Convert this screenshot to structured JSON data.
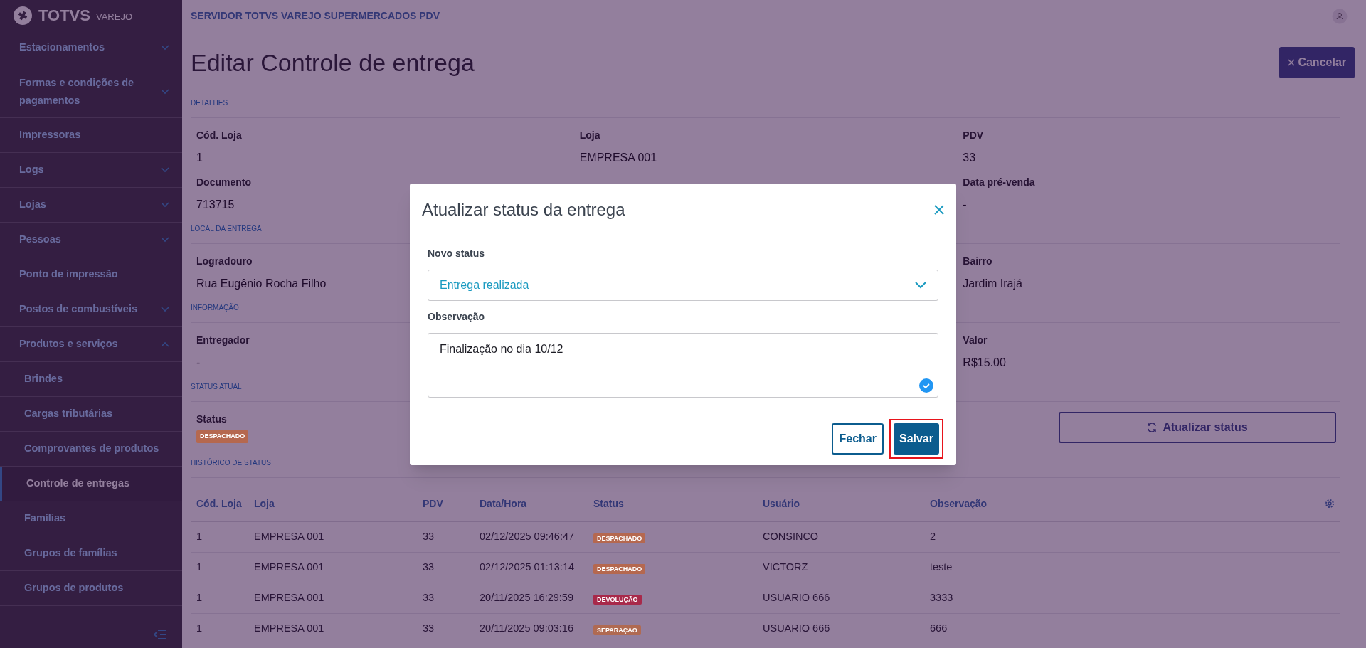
{
  "sidebar": {
    "brand": "TOTVS",
    "brand_sub": "VAREJO",
    "items": [
      {
        "label": "Estacionamentos",
        "kind": "group",
        "expanded": false
      },
      {
        "label": "Formas e condições de pagamentos",
        "kind": "group",
        "expanded": false
      },
      {
        "label": "Impressoras",
        "kind": "link"
      },
      {
        "label": "Logs",
        "kind": "group",
        "expanded": false
      },
      {
        "label": "Lojas",
        "kind": "group",
        "expanded": false
      },
      {
        "label": "Pessoas",
        "kind": "group",
        "expanded": false
      },
      {
        "label": "Ponto de impressão",
        "kind": "link"
      },
      {
        "label": "Postos de combustíveis",
        "kind": "group",
        "expanded": false
      },
      {
        "label": "Produtos e serviços",
        "kind": "group",
        "expanded": true,
        "children": [
          {
            "label": "Brindes",
            "selected": false
          },
          {
            "label": "Cargas tributárias",
            "selected": false
          },
          {
            "label": "Comprovantes de produtos",
            "selected": false
          },
          {
            "label": "Controle de entregas",
            "selected": true
          },
          {
            "label": "Famílias",
            "selected": false
          },
          {
            "label": "Grupos de famílias",
            "selected": false
          },
          {
            "label": "Grupos de produtos",
            "selected": false
          }
        ]
      }
    ]
  },
  "topbar": {
    "title": "SERVIDOR TOTVS VAREJO SUPERMERCADOS PDV"
  },
  "page": {
    "title": "Editar Controle de entrega",
    "cancel_button": "Cancelar",
    "sections": [
      {
        "heading": "DETALHES",
        "fields": [
          {
            "kind": "field",
            "label": "Cód. Loja",
            "value": "1"
          },
          {
            "kind": "field",
            "label": "Loja",
            "value": "EMPRESA 001"
          },
          {
            "kind": "field",
            "label": "PDV",
            "value": "33"
          },
          {
            "kind": "field",
            "label": "Documento",
            "value": "713715"
          },
          {
            "kind": "hidden"
          },
          {
            "kind": "field",
            "label": "Data pré-venda",
            "value": "-"
          }
        ]
      },
      {
        "heading": "LOCAL DA ENTREGA",
        "fields": [
          {
            "kind": "field",
            "label": "Logradouro",
            "value": "Rua Eugênio Rocha Filho"
          },
          {
            "kind": "hidden"
          },
          {
            "kind": "field",
            "label": "Bairro",
            "value": "Jardim Irajá"
          }
        ]
      },
      {
        "heading": "INFORMAÇÃO",
        "fields": [
          {
            "kind": "field",
            "label": "Entregador",
            "value": "-"
          },
          {
            "kind": "hidden"
          },
          {
            "kind": "field",
            "label": "Valor",
            "value": "R$15.00"
          }
        ]
      }
    ],
    "status_section": {
      "heading": "STATUS ATUAL",
      "label": "Status",
      "badge": {
        "label": "DESPACHADO",
        "color": "#b5684f"
      },
      "update_button": "Atualizar status"
    },
    "history": {
      "heading": "HISTÓRICO DE STATUS",
      "columns": [
        "Cód. Loja",
        "Loja",
        "PDV",
        "Data/Hora",
        "Status",
        "Usuário",
        "Observação"
      ],
      "rows": [
        {
          "cells": [
            "1",
            "EMPRESA 001",
            "33",
            "02/12/2025 09:46:47",
            "DESPACHADO",
            "CONSINCO",
            "2"
          ],
          "color": "#b5684f"
        },
        {
          "cells": [
            "1",
            "EMPRESA 001",
            "33",
            "02/12/2025 01:13:14",
            "DESPACHADO",
            "VICTORZ",
            "teste"
          ],
          "color": "#b5684f"
        },
        {
          "cells": [
            "1",
            "EMPRESA 001",
            "33",
            "20/11/2025 16:29:59",
            "DEVOLUÇÃO",
            "USUARIO 666",
            "3333"
          ],
          "color": "#a8294a"
        },
        {
          "cells": [
            "1",
            "EMPRESA 001",
            "33",
            "20/11/2025 09:03:16",
            "SEPARAÇÃO",
            "USUARIO 666",
            "666"
          ],
          "color": "#b06a52"
        }
      ]
    }
  },
  "modal": {
    "title": "Atualizar status da entrega",
    "status_label": "Novo status",
    "status_value": "Entrega realizada",
    "note_label": "Observação",
    "note_value": "Finalização no dia 10/12",
    "note_valid": true,
    "buttons": [
      {
        "label": "Fechar",
        "kind": "secondary",
        "highlighted": false
      },
      {
        "label": "Salvar",
        "kind": "primary",
        "highlighted": true
      }
    ]
  }
}
